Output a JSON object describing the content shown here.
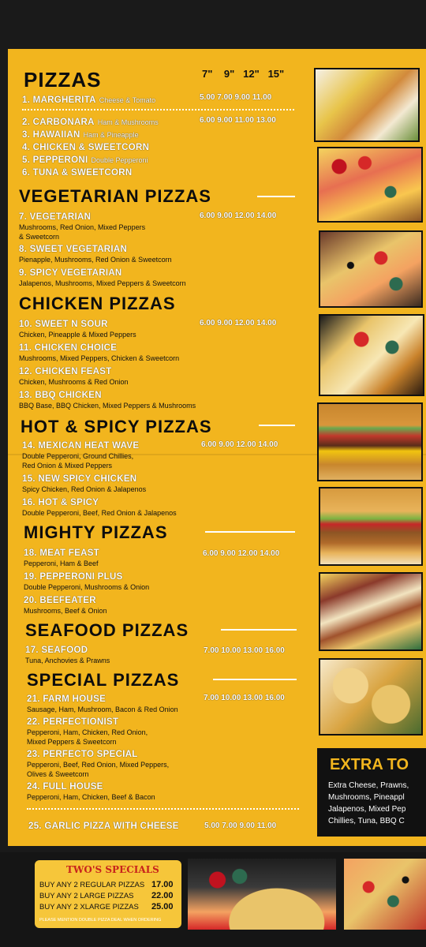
{
  "sizes": [
    "7\"",
    "9\"",
    "12\"",
    "15\""
  ],
  "sections": {
    "pizzas": "PIZZAS",
    "vegetarian": "VEGETARIAN PIZZAS",
    "chicken": "CHICKEN PIZZAS",
    "hot_spicy": "HOT & SPICY PIZZAS",
    "mighty": "MIGHTY PIZZAS",
    "seafood": "SEAFOOD PIZZAS",
    "special": "SPECIAL PIZZAS"
  },
  "items": [
    {
      "name": "1. MARGHERITA",
      "inline": "Cheese & Tomato",
      "prices": "5.00  7.00  9.00  11.00"
    },
    {
      "name": "2. CARBONARA",
      "inline": "Ham & Mushrooms",
      "prices": "6.00  9.00  11.00  13.00"
    },
    {
      "name": "3. HAWAIIAN",
      "inline": "Ham & Pineapple"
    },
    {
      "name": "4. CHICKEN & SWEETCORN"
    },
    {
      "name": "5. PEPPERONI",
      "inline": "Double Pepperoni"
    },
    {
      "name": "6. TUNA & SWEETCORN"
    },
    {
      "name": "7. VEGETARIAN",
      "desc": [
        "Mushrooms, Red Onion, Mixed Peppers",
        "& Sweetcorn"
      ],
      "prices": "6.00  9.00  12.00  14.00"
    },
    {
      "name": "8. SWEET VEGETARIAN",
      "desc": [
        "Pienapple, Mushrooms, Red Onion & Sweetcorn"
      ]
    },
    {
      "name": "9. SPICY VEGETARIAN",
      "desc": [
        "Jalapenos, Mushrooms, Mixed Peppers & Sweetcorn"
      ]
    },
    {
      "name": "10. SWEET N SOUR",
      "desc": [
        "Chicken, Pineapple & Mixed Peppers"
      ],
      "prices": "6.00  9.00  12.00  14.00"
    },
    {
      "name": "11. CHICKEN CHOICE",
      "desc": [
        "Mushrooms, Mixed Peppers, Chicken & Sweetcorn"
      ]
    },
    {
      "name": "12. CHICKEN FEAST",
      "desc": [
        "Chicken, Mushrooms & Red Onion"
      ]
    },
    {
      "name": "13. BBQ CHICKEN",
      "desc": [
        "BBQ Base, BBQ Chicken, Mixed Peppers & Mushrooms"
      ]
    },
    {
      "name": "14. MEXICAN HEAT WAVE",
      "desc": [
        "Double Pepperoni, Ground Chillies,",
        "Red Onion & Mixed Peppers"
      ],
      "prices": "6.00  9.00  12.00  14.00"
    },
    {
      "name": "15. NEW SPICY CHICKEN",
      "desc": [
        "Spicy Chicken, Red Onion & Jalapenos"
      ]
    },
    {
      "name": "16. HOT & SPICY",
      "desc": [
        "Double Pepperoni, Beef, Red Onion & Jalapenos"
      ]
    },
    {
      "name": "18. MEAT FEAST",
      "desc": [
        "Pepperoni, Ham & Beef"
      ],
      "prices": "6.00  9.00  12.00  14.00"
    },
    {
      "name": "19. PEPPERONI PLUS",
      "desc": [
        "Double Pepperoni, Mushrooms & Onion"
      ]
    },
    {
      "name": "20. BEEFEATER",
      "desc": [
        "Mushrooms, Beef & Onion"
      ]
    },
    {
      "name": "17. SEAFOOD",
      "desc": [
        "Tuna, Anchovies & Prawns"
      ],
      "prices": "7.00  10.00  13.00  16.00"
    },
    {
      "name": "21. FARM HOUSE",
      "desc": [
        "Sausage, Ham, Mushroom, Bacon & Red Onion"
      ],
      "prices": "7.00  10.00  13.00  16.00"
    },
    {
      "name": "22. PERFECTIONIST",
      "desc": [
        "Pepperoni, Ham, Chicken, Red Onion,",
        "Mixed Peppers & Sweetcorn"
      ]
    },
    {
      "name": "23. PERFECTO SPECIAL",
      "desc": [
        "Pepperoni, Beef, Red Onion, Mixed Peppers,",
        "Olives & Sweetcorn"
      ]
    },
    {
      "name": "24. FULL HOUSE",
      "desc": [
        "Pepperoni, Ham, Chicken, Beef & Bacon"
      ]
    },
    {
      "name": "25. GARLIC PIZZA WITH CHEESE",
      "prices": "5.00  7.00  9.00  11.00"
    }
  ],
  "extra": {
    "title": "EXTRA TO",
    "lines": [
      "Extra Cheese, Prawns,",
      "Mushrooms, Pineappl",
      "Jalapenos, Mixed Pep",
      "Chillies, Tuna, BBQ C"
    ]
  },
  "twos": {
    "title": "TWO'S SPECIALS",
    "rows": [
      {
        "label": "BUY ANY 2 REGULAR PIZZAS",
        "price": "17.00"
      },
      {
        "label": "BUY ANY 2 LARGE PIZZAS",
        "price": "22.00"
      },
      {
        "label": "BUY ANY 2 XLARGE PIZZAS",
        "price": "25.00"
      }
    ],
    "note": "PLEASE MENTION DOUBLE PIZZA DEAL WHEN ORDERING"
  },
  "colors": {
    "background": "#f2b51e",
    "text_dark": "#0d0d0d",
    "accent_red": "#c8231c"
  }
}
